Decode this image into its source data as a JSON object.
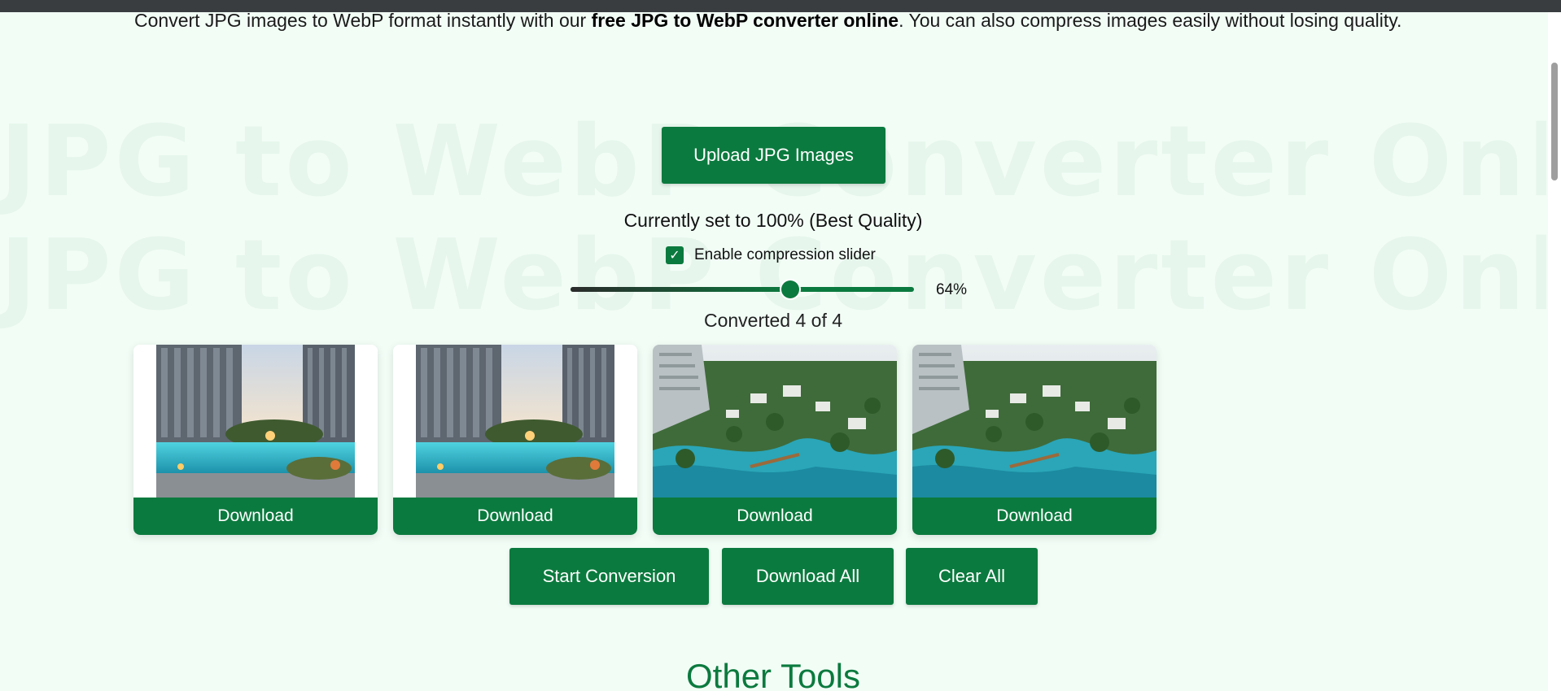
{
  "intro": {
    "prefix": "Convert JPG images to WebP format instantly with our ",
    "bold": "free JPG to WebP converter online",
    "suffix": ". You can also compress images easily without losing quality."
  },
  "watermark": {
    "line1": "JPG to WebP Converter Online Free",
    "line2": "JPG to WebP Converter Online Free"
  },
  "upload": {
    "label": "Upload JPG Images"
  },
  "quality": {
    "text": "Currently set to 100% (Best Quality)"
  },
  "compression": {
    "checkbox_mark": "✓",
    "label": "Enable compression slider",
    "slider_value": 64,
    "slider_label": "64%"
  },
  "status": {
    "converted": "Converted 4 of 4"
  },
  "images": [
    {
      "kind": "tower",
      "download_label": "Download"
    },
    {
      "kind": "tower",
      "download_label": "Download"
    },
    {
      "kind": "river",
      "download_label": "Download"
    },
    {
      "kind": "river",
      "download_label": "Download"
    }
  ],
  "actions": {
    "start": "Start Conversion",
    "download_all": "Download All",
    "clear": "Clear All"
  },
  "section": {
    "other_tools": "Other Tools"
  },
  "colors": {
    "brand": "#0b7a3e",
    "background": "#f2fdf6"
  }
}
